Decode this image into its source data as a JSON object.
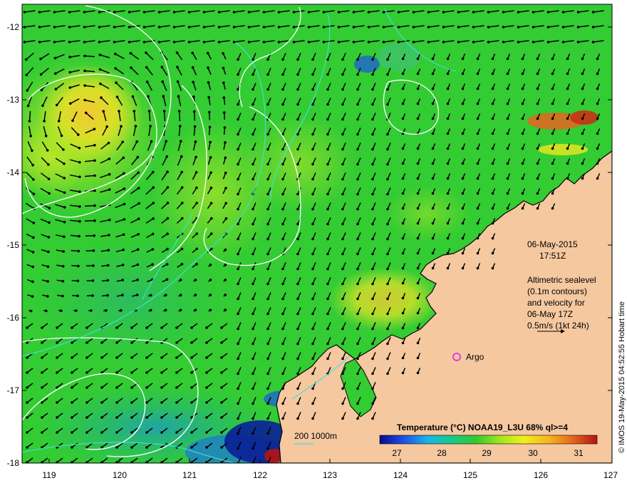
{
  "map": {
    "lon_range": [
      118.6,
      127.0
    ],
    "lat_range": [
      -18.0,
      -11.9
    ],
    "x_ticks": [
      "119",
      "120",
      "121",
      "122",
      "123",
      "124",
      "125",
      "126",
      "127"
    ],
    "y_ticks": [
      "-12",
      "-13",
      "-14",
      "-15",
      "-16",
      "-17",
      "-18"
    ]
  },
  "annotations": {
    "date": "06-May-2015",
    "time": "17:51Z",
    "sealevel_lines": [
      "Altimetric sealevel",
      "(0.1m contours)",
      "and velocity for",
      "06-May 17Z",
      "0.5m/s (1kt 24h)"
    ],
    "argo_label": "Argo",
    "depth_scale": "200  1000m",
    "credit": "© IMOS 19-May-2015 04:52:55 Hobart time"
  },
  "colorbar": {
    "title": "Temperature (°C) NOAA19_L3U 68% ql>=4",
    "ticks": [
      "27",
      "28",
      "29",
      "30",
      "31"
    ],
    "colors": [
      "#0a0a8c",
      "#1e50e6",
      "#19b4e6",
      "#19c88c",
      "#32c832",
      "#9be61e",
      "#f0f01e",
      "#f5b41e",
      "#e6641e",
      "#b41414"
    ]
  },
  "colors": {
    "land": "#f5c8a0",
    "ocean": "#33cc33",
    "contour": "#ffffff",
    "isobath": "#40e0e0",
    "argo": "#e040e0"
  }
}
